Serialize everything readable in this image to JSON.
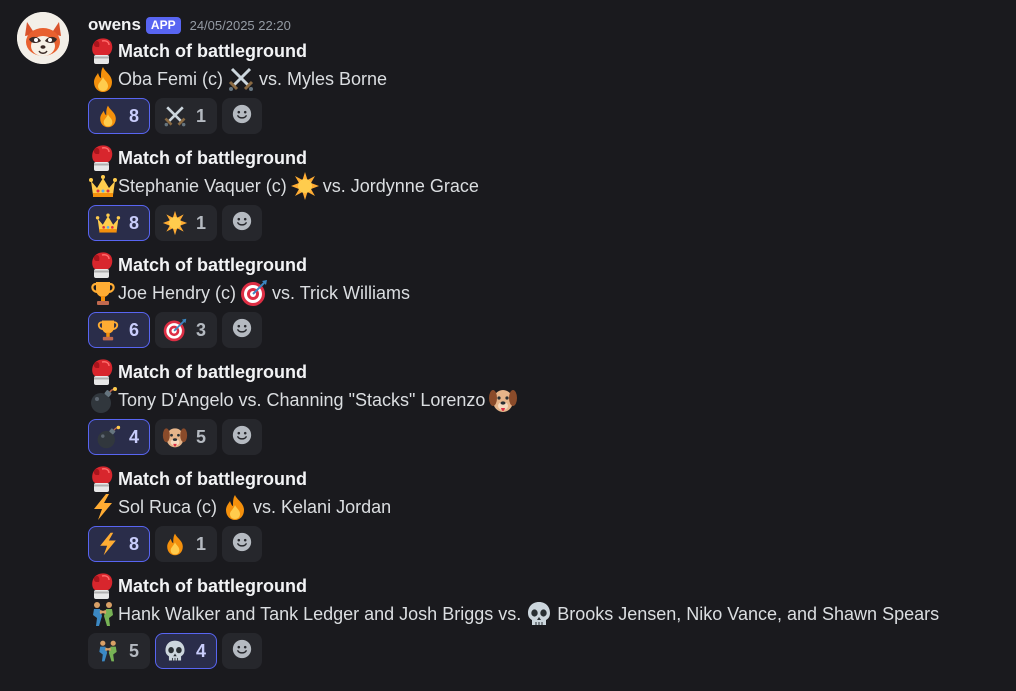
{
  "author": {
    "name": "owens",
    "tag": "APP",
    "timestamp": "24/05/2025 22:20"
  },
  "heading_emoji": "boxing-glove-icon",
  "matches": [
    {
      "title": "Match of battleground",
      "left_emoji": "fire-icon",
      "left_text": "Oba Femi (c)",
      "right_emoji": "crossed-swords-icon",
      "right_text": "vs. Myles Borne",
      "reactions": [
        {
          "emoji": "fire-icon",
          "count": "8",
          "active": true
        },
        {
          "emoji": "crossed-swords-icon",
          "count": "1",
          "active": false
        }
      ]
    },
    {
      "title": "Match of battleground",
      "left_emoji": "crown-icon",
      "left_text": "Stephanie Vaquer (c)",
      "right_emoji": "sun-icon",
      "right_text": "vs. Jordynne Grace",
      "reactions": [
        {
          "emoji": "crown-icon",
          "count": "8",
          "active": true
        },
        {
          "emoji": "sun-icon",
          "count": "1",
          "active": false
        }
      ]
    },
    {
      "title": "Match of battleground",
      "left_emoji": "trophy-icon",
      "left_text": "Joe Hendry (c)",
      "right_emoji": "bullseye-icon",
      "right_text": "vs. Trick Williams",
      "reactions": [
        {
          "emoji": "trophy-icon",
          "count": "6",
          "active": true
        },
        {
          "emoji": "bullseye-icon",
          "count": "3",
          "active": false
        }
      ]
    },
    {
      "title": "Match of battleground",
      "left_emoji": "bomb-icon",
      "left_text": "Tony D'Angelo  vs. Channing \"Stacks\" Lorenzo",
      "right_emoji": "dog-face-icon",
      "right_text": "",
      "reactions": [
        {
          "emoji": "bomb-icon",
          "count": "4",
          "active": true
        },
        {
          "emoji": "dog-face-icon",
          "count": "5",
          "active": false
        }
      ]
    },
    {
      "title": "Match of battleground",
      "left_emoji": "lightning-icon",
      "left_text": "Sol Ruca (c)",
      "right_emoji": "fire-icon",
      "right_text": "vs. Kelani Jordan",
      "reactions": [
        {
          "emoji": "lightning-icon",
          "count": "8",
          "active": true
        },
        {
          "emoji": "fire-icon",
          "count": "1",
          "active": false
        }
      ]
    },
    {
      "title": "Match of battleground",
      "left_emoji": "wrestlers-icon",
      "left_text": "Hank Walker  and Tank Ledger and Josh Briggs vs.",
      "right_emoji": "skull-icon",
      "right_text": "Brooks Jensen, Niko Vance, and Shawn Spears",
      "reactions": [
        {
          "emoji": "wrestlers-icon",
          "count": "5",
          "active": false
        },
        {
          "emoji": "skull-icon",
          "count": "4",
          "active": true
        }
      ]
    }
  ]
}
